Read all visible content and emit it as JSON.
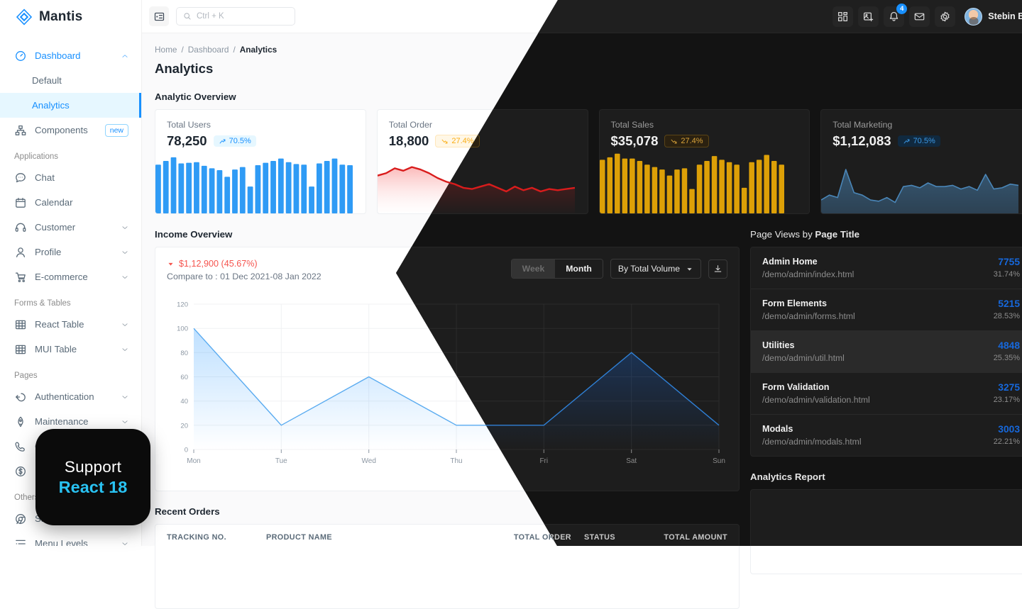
{
  "brand": {
    "name": "Mantis"
  },
  "sidebar": {
    "items": [
      {
        "label": "Dashboard",
        "icon": "dashboard-icon",
        "active": true,
        "chevron": "up"
      },
      {
        "label": "Default",
        "sub": true
      },
      {
        "label": "Analytics",
        "sub": true,
        "selected": true
      },
      {
        "label": "Components",
        "icon": "components-icon",
        "badge": "new"
      }
    ],
    "caption_applications": "Applications",
    "applications": [
      {
        "label": "Chat",
        "icon": "chat-icon"
      },
      {
        "label": "Calendar",
        "icon": "calendar-icon"
      },
      {
        "label": "Customer",
        "icon": "headset-icon",
        "chevron": "down"
      },
      {
        "label": "Profile",
        "icon": "user-icon",
        "chevron": "down"
      },
      {
        "label": "E-commerce",
        "icon": "cart-icon",
        "chevron": "down"
      }
    ],
    "caption_forms": "Forms & Tables",
    "forms": [
      {
        "label": "React Table",
        "icon": "table-icon",
        "chevron": "down"
      },
      {
        "label": "MUI Table",
        "icon": "table-icon",
        "chevron": "down"
      }
    ],
    "caption_pages": "Pages",
    "pages": [
      {
        "label": "Authentication",
        "icon": "login-icon",
        "chevron": "down"
      },
      {
        "label": "Maintenance",
        "icon": "rocket-icon",
        "chevron": "down"
      },
      {
        "label": "Contact US",
        "icon": "phone-icon"
      },
      {
        "label": "Pricing",
        "icon": "dollar-icon"
      }
    ],
    "caption_others": "Others",
    "others": [
      {
        "label": "Sample Page",
        "icon": "chrome-icon"
      },
      {
        "label": "Menu Levels",
        "icon": "menu-levels-icon",
        "chevron": "down"
      }
    ]
  },
  "topbar": {
    "menu_toggle": "menu-toggle",
    "search_placeholder": "Ctrl + K",
    "notification_count": "4",
    "user_name": "Stebin Ben"
  },
  "breadcrumb": {
    "home": "Home",
    "sep": "/",
    "dashboard": "Dashboard",
    "current": "Analytics"
  },
  "page": {
    "title": "Analytics"
  },
  "sections": {
    "analytic_overview": "Analytic Overview",
    "income_overview": "Income Overview",
    "page_views_a": "Page Views by ",
    "page_views_b": "Page Title",
    "recent_orders": "Recent Orders",
    "analytics_report": "Analytics Report"
  },
  "kpis": [
    {
      "label": "Total Users",
      "value": "78,250",
      "pct": "70.5%",
      "dir": "up",
      "tone": "blue",
      "chart": "bars-blue"
    },
    {
      "label": "Total Order",
      "value": "18,800",
      "pct": "27.4%",
      "dir": "down",
      "tone": "gold",
      "chart": "area-red"
    },
    {
      "label": "Total Sales",
      "value": "$35,078",
      "pct": "27.4%",
      "dir": "down",
      "tone": "gold",
      "chart": "bars-gold"
    },
    {
      "label": "Total Marketing",
      "value": "$1,12,083",
      "pct": "70.5%",
      "dir": "up",
      "tone": "blue",
      "chart": "area-blue"
    }
  ],
  "income": {
    "delta": "$1,12,900 (45.67%)",
    "compare": "Compare to : 01 Dec 2021-08 Jan 2022",
    "tab_week": "Week",
    "tab_month": "Month",
    "select_value": "By Total Volume",
    "download": "download-icon"
  },
  "page_views": [
    {
      "title": "Admin Home",
      "url": "/demo/admin/index.html",
      "count": "7755",
      "pct": "31.74%",
      "highlight": false
    },
    {
      "title": "Form Elements",
      "url": "/demo/admin/forms.html",
      "count": "5215",
      "pct": "28.53%",
      "highlight": false
    },
    {
      "title": "Utilities",
      "url": "/demo/admin/util.html",
      "count": "4848",
      "pct": "25.35%",
      "highlight": true
    },
    {
      "title": "Form Validation",
      "url": "/demo/admin/validation.html",
      "count": "3275",
      "pct": "23.17%",
      "highlight": false
    },
    {
      "title": "Modals",
      "url": "/demo/admin/modals.html",
      "count": "3003",
      "pct": "22.21%",
      "highlight": false
    }
  ],
  "recent_orders": {
    "columns": [
      "TRACKING NO.",
      "PRODUCT NAME",
      "TOTAL ORDER",
      "STATUS",
      "TOTAL AMOUNT"
    ]
  },
  "support_badge": {
    "line1": "Support",
    "line2": "React 18"
  },
  "colors": {
    "accent_blue": "#1890ff",
    "gold": "#faad14",
    "red": "#f5544e",
    "dark_bg": "#131313",
    "dark_card": "#1d1d1d",
    "support_cyan": "#29c2f2"
  },
  "chart_data": [
    {
      "type": "bar",
      "title": "Total Users",
      "categories": [
        "1",
        "2",
        "3",
        "4",
        "5",
        "6",
        "7",
        "8",
        "9",
        "10",
        "11",
        "12",
        "13",
        "14",
        "15",
        "16",
        "17",
        "18",
        "19",
        "20",
        "21",
        "22",
        "23",
        "24",
        "25",
        "26"
      ],
      "values": [
        80,
        86,
        92,
        82,
        83,
        84,
        78,
        74,
        71,
        60,
        72,
        76,
        44,
        79,
        83,
        86,
        90,
        84,
        81,
        80,
        44,
        82,
        86,
        90,
        80,
        79
      ],
      "ylim": [
        0,
        100
      ],
      "color": "#1890ff"
    },
    {
      "type": "area",
      "title": "Total Order",
      "x": [
        0,
        1,
        2,
        3,
        4,
        5,
        6,
        7,
        8,
        9,
        10,
        11,
        12,
        13,
        14,
        15,
        16,
        17,
        18,
        19,
        20,
        21,
        22,
        23
      ],
      "values": [
        62,
        66,
        74,
        70,
        76,
        72,
        66,
        58,
        52,
        48,
        42,
        40,
        44,
        48,
        42,
        36,
        44,
        38,
        42,
        36,
        40,
        38,
        40,
        42
      ],
      "ylim": [
        0,
        100
      ],
      "color": "#d91c1c"
    },
    {
      "type": "bar",
      "title": "Total Sales",
      "categories": [
        "1",
        "2",
        "3",
        "4",
        "5",
        "6",
        "7",
        "8",
        "9",
        "10",
        "11",
        "12",
        "13",
        "14",
        "15",
        "16",
        "17",
        "18",
        "19",
        "20",
        "21",
        "22",
        "23",
        "24",
        "25"
      ],
      "values": [
        88,
        92,
        98,
        90,
        90,
        86,
        80,
        76,
        72,
        62,
        72,
        74,
        40,
        80,
        86,
        94,
        88,
        84,
        80,
        42,
        84,
        88,
        96,
        86,
        80
      ],
      "ylim": [
        0,
        100
      ],
      "color": "#dda007"
    },
    {
      "type": "area",
      "title": "Total Marketing",
      "x": [
        0,
        1,
        2,
        3,
        4,
        5,
        6,
        7,
        8,
        9,
        10,
        11,
        12,
        13,
        14,
        15,
        16,
        17,
        18,
        19,
        20,
        21,
        22,
        23,
        24
      ],
      "values": [
        22,
        30,
        26,
        72,
        34,
        30,
        22,
        20,
        26,
        18,
        44,
        46,
        42,
        50,
        44,
        44,
        46,
        40,
        44,
        38,
        64,
        40,
        42,
        48,
        46
      ],
      "ylim": [
        0,
        100
      ],
      "color": "#3c7ebf"
    },
    {
      "type": "area",
      "title": "Income Overview",
      "categories": [
        "Mon",
        "Tue",
        "Wed",
        "Thu",
        "Fri",
        "Sat",
        "Sun"
      ],
      "values": [
        100,
        20,
        60,
        20,
        20,
        80,
        20
      ],
      "ylim": [
        0,
        120
      ],
      "yticks": [
        0,
        20,
        40,
        60,
        80,
        100,
        120
      ],
      "xlabel": "",
      "ylabel": "",
      "grid": true,
      "color": "#1890ff"
    }
  ]
}
